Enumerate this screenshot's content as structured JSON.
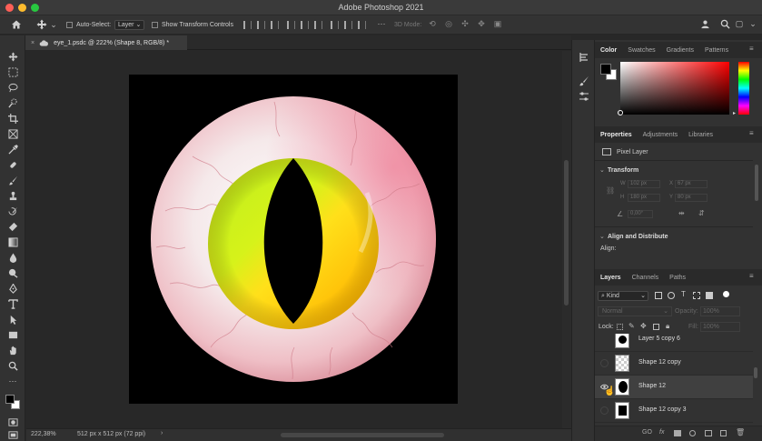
{
  "window": {
    "title": "Adobe Photoshop 2021"
  },
  "options_bar": {
    "auto_select_label": "Auto-Select:",
    "auto_select_value": "Layer",
    "transform_controls_label": "Show Transform Controls",
    "mode_3d_label": "3D Mode:"
  },
  "document": {
    "tab_label": "eye_1.psdc @ 222% (Shape 8, RGB/8) *",
    "zoom": "222,38%",
    "dimensions": "512 px x 512 px (72 ppi)"
  },
  "panels": {
    "color_tabs": [
      "Color",
      "Swatches",
      "Gradients",
      "Patterns"
    ],
    "properties_tabs": [
      "Properties",
      "Adjustments",
      "Libraries"
    ],
    "properties": {
      "layer_type": "Pixel Layer",
      "transform_label": "Transform",
      "w_label": "W",
      "w_value": "102 px",
      "x_label": "X",
      "x_value": "67 px",
      "h_label": "H",
      "h_value": "180 px",
      "y_label": "Y",
      "y_value": "80 px",
      "angle_value": "0,00°",
      "align_label": "Align and Distribute",
      "align_sub": "Align:"
    },
    "layers_tabs": [
      "Layers",
      "Channels",
      "Paths"
    ],
    "layers": {
      "kind_label": "Kind",
      "blend_mode": "Normal",
      "opacity_label": "Opacity:",
      "opacity_value": "100%",
      "lock_label": "Lock:",
      "fill_label": "Fill:",
      "fill_value": "100%",
      "items": [
        {
          "name": "Layer 5 copy 6"
        },
        {
          "name": "Shape 12 copy"
        },
        {
          "name": "Shape 12"
        },
        {
          "name": "Shape 12 copy 3"
        }
      ]
    }
  },
  "colors": {
    "foreground": "#000000",
    "background": "#ffffff",
    "sclera": "#f2e4e6",
    "iris_yellow": "#ffd000",
    "iris_green": "#c8f000"
  }
}
